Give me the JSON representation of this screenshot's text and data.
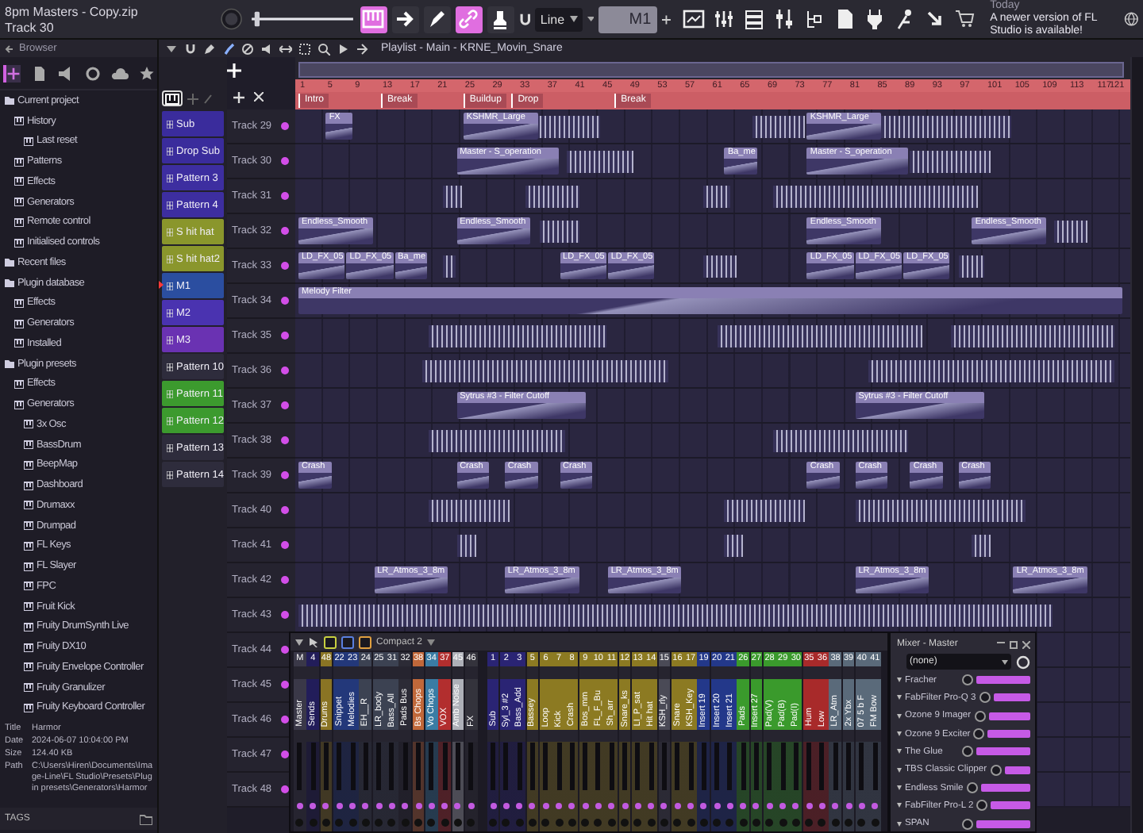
{
  "window": {
    "title": "8pm Masters - Copy.zip",
    "subtitle": "Track 30"
  },
  "toolbar": {
    "master_slider": {
      "level": 0.03
    },
    "toggles": [
      {
        "on": true
      },
      {
        "on": false
      },
      {
        "on": false
      },
      {
        "on": true
      },
      {
        "on": false
      }
    ],
    "snap": "Line",
    "pattern": "M1",
    "notice": {
      "date": "Today",
      "message": "A newer version of FL Studio is available!"
    }
  },
  "browser": {
    "title": "Browser",
    "tabs": [
      {
        "selected": true
      },
      {
        "selected": false
      },
      {
        "selected": false
      },
      {
        "selected": false
      },
      {
        "selected": false
      },
      {
        "selected": false
      }
    ],
    "tree": [
      {
        "label": "Current project",
        "children": [
          {
            "label": "History",
            "children": [
              {
                "label": "Last reset"
              }
            ]
          },
          {
            "label": "Patterns"
          },
          {
            "label": "Effects"
          },
          {
            "label": "Generators"
          },
          {
            "label": "Remote control"
          },
          {
            "label": "Initialised controls"
          }
        ]
      },
      {
        "label": "Recent files"
      },
      {
        "label": "Plugin database",
        "children": [
          {
            "label": "Effects"
          },
          {
            "label": "Generators"
          },
          {
            "label": "Installed"
          }
        ]
      },
      {
        "label": "Plugin presets",
        "children": [
          {
            "label": "Effects"
          },
          {
            "label": "Generators",
            "children": [
              {
                "label": "3x Osc"
              },
              {
                "label": "BassDrum"
              },
              {
                "label": "BeepMap"
              },
              {
                "label": "Dashboard"
              },
              {
                "label": "Drumaxx"
              },
              {
                "label": "Drumpad"
              },
              {
                "label": "FL Keys"
              },
              {
                "label": "FL Slayer"
              },
              {
                "label": "FPC"
              },
              {
                "label": "Fruit Kick"
              },
              {
                "label": "Fruity DrumSynth Live"
              },
              {
                "label": "Fruity DX10"
              },
              {
                "label": "Fruity Envelope Controller"
              },
              {
                "label": "Fruity Granulizer"
              },
              {
                "label": "Fruity Keyboard Controller"
              }
            ]
          }
        ]
      }
    ],
    "info": [
      {
        "label": "Title",
        "value": "Harmor"
      },
      {
        "label": "Date",
        "value": "2024-06-07 10:04:00 PM"
      },
      {
        "label": "Size",
        "value": "124.40 KB"
      },
      {
        "label": "Path",
        "value": "C:\\Users\\Hiren\\Documents\\Image-Line\\FL Studio\\Presets\\Plugin presets\\Generators\\Harmor"
      }
    ],
    "tags": "TAGS"
  },
  "patterns": [
    {
      "name": "Sub",
      "color": "#3a2c9c",
      "selected": false
    },
    {
      "name": "Drop Sub",
      "color": "#3a2c9c",
      "selected": false
    },
    {
      "name": "Pattern 3",
      "color": "#3d2ea0",
      "selected": false
    },
    {
      "name": "Pattern 4",
      "color": "#3d2ea0",
      "selected": false
    },
    {
      "name": "S hit hat",
      "color": "#8a962c",
      "selected": false
    },
    {
      "name": "S hit hat2",
      "color": "#8a962c",
      "selected": false
    },
    {
      "name": "M1",
      "color": "#2b4ea0",
      "selected": true
    },
    {
      "name": "M2",
      "color": "#4a33b0",
      "selected": false
    },
    {
      "name": "M3",
      "color": "#6a32b2",
      "selected": false
    },
    {
      "name": "Pattern 10",
      "color": "#2e2c3c",
      "selected": false
    },
    {
      "name": "Pattern 11",
      "color": "#3c9a2e",
      "selected": false
    },
    {
      "name": "Pattern 12",
      "color": "#3c9a2e",
      "selected": false
    },
    {
      "name": "Pattern 13",
      "color": "#2e2c3c",
      "selected": false
    },
    {
      "name": "Pattern 14",
      "color": "#2e2c3c",
      "selected": false
    }
  ],
  "playlist": {
    "title": "Playlist - Main - KRNE_Movin_Snare",
    "ruler": [
      "1",
      "5",
      "9",
      "13",
      "17",
      "21",
      "25",
      "29",
      "33",
      "37",
      "41",
      "45",
      "49",
      "53",
      "57",
      "61",
      "65",
      "69",
      "73",
      "77",
      "81",
      "85",
      "89",
      "93",
      "97",
      "101",
      "105",
      "109",
      "113",
      "117",
      "121"
    ],
    "markers": [
      "Intro",
      "Break",
      "Buildup",
      "Drop",
      "Break"
    ],
    "tracks": [
      {
        "name": "Track 29",
        "enabled": true,
        "clips": [
          {
            "label": "FX"
          },
          {
            "label": "KSHMR_Large"
          },
          {
            "label": "KSHMR_Large"
          }
        ]
      },
      {
        "name": "Track 30",
        "enabled": true,
        "clips": [
          {
            "label": "Master - S_operation"
          },
          {
            "label": "Ba_me"
          },
          {
            "label": "Master - S_operation"
          }
        ]
      },
      {
        "name": "Track 31",
        "enabled": true
      },
      {
        "name": "Track 32",
        "enabled": true,
        "clips": [
          {
            "label": "Endless_Smooth"
          },
          {
            "label": "Endless_Smooth"
          },
          {
            "label": "Endless_Smooth"
          },
          {
            "label": "Endless_Smooth"
          }
        ]
      },
      {
        "name": "Track 33",
        "enabled": true,
        "clips": [
          {
            "label": "LD_FX_05"
          },
          {
            "label": "LD_FX_05"
          },
          {
            "label": "Ba_me"
          },
          {
            "label": "LD_FX_05"
          },
          {
            "label": "LD_FX_05"
          },
          {
            "label": "LD_FX_05"
          },
          {
            "label": "LD_FX_05"
          },
          {
            "label": "LD_FX_05"
          }
        ]
      },
      {
        "name": "Track 34",
        "enabled": true,
        "clips": [
          {
            "label": "Melody Filter"
          }
        ]
      },
      {
        "name": "Track 35",
        "enabled": true
      },
      {
        "name": "Track 36",
        "enabled": true
      },
      {
        "name": "Track 37",
        "enabled": true,
        "clips": [
          {
            "label": "Sytrus #3 - Filter Cutoff"
          },
          {
            "label": "Sytrus #3 - Filter Cutoff"
          }
        ]
      },
      {
        "name": "Track 38",
        "enabled": true
      },
      {
        "name": "Track 39",
        "enabled": true,
        "clips": [
          {
            "label": "Crash"
          },
          {
            "label": "Crash"
          },
          {
            "label": "Crash"
          },
          {
            "label": "Crash"
          },
          {
            "label": "Crash"
          },
          {
            "label": "Crash"
          },
          {
            "label": "Crash"
          },
          {
            "label": "Crash"
          }
        ]
      },
      {
        "name": "Track 40",
        "enabled": true
      },
      {
        "name": "Track 41",
        "enabled": true
      },
      {
        "name": "Track 42",
        "enabled": true,
        "clips": [
          {
            "label": "LR_Atmos_3_8m"
          },
          {
            "label": "LR_Atmos_3_8m"
          },
          {
            "label": "LR_Atmos_3_8m"
          },
          {
            "label": "LR_Atmos_3_8m"
          },
          {
            "label": "LR_Atmos_3_8m"
          }
        ]
      },
      {
        "name": "Track 43",
        "enabled": true
      },
      {
        "name": "Track 44",
        "enabled": true
      },
      {
        "name": "Track 45",
        "enabled": true
      },
      {
        "name": "Track 46",
        "enabled": true
      },
      {
        "name": "Track 47",
        "enabled": true
      },
      {
        "name": "Track 48",
        "enabled": true
      }
    ]
  },
  "mixer": {
    "preset": "Compact 2",
    "groups": [
      {
        "strips": [
          {
            "number": "M",
            "name": "Master",
            "color": "#3a3848"
          },
          {
            "number": "4",
            "name": "Sends",
            "color": "#221d5a"
          },
          {
            "number": "48",
            "name": "Drums",
            "color": "#8a7424"
          },
          {
            "number": "22",
            "name": "Snippet",
            "color": "#23387a"
          },
          {
            "number": "23",
            "name": "Melodies",
            "color": "#23387a"
          },
          {
            "number": "24",
            "name": "EH__R",
            "color": "#3c4252"
          },
          {
            "number": "25",
            "name": "LR_body",
            "color": "#3c4252"
          },
          {
            "number": "31",
            "name": "Bass_All",
            "color": "#3c4252"
          },
          {
            "number": "32",
            "name": "Pads Bus",
            "color": "#2c2b36"
          },
          {
            "number": "38",
            "name": "Bs Chops",
            "color": "#c0683a"
          },
          {
            "number": "34",
            "name": "Vo Chops",
            "color": "#3a7ca4"
          },
          {
            "number": "37",
            "name": "VOX",
            "color": "#b22e2e"
          },
          {
            "number": "45",
            "name": "Amb Noise",
            "color": "#aeb0b8"
          },
          {
            "number": "46",
            "name": "FX",
            "color": "#34333c"
          }
        ]
      },
      {
        "strips": [
          {
            "number": "1",
            "name": "Sub",
            "color": "#2a2474"
          },
          {
            "number": "2",
            "name": "Syl_3 #2",
            "color": "#2a2474"
          },
          {
            "number": "3",
            "name": "Bass_Add",
            "color": "#2a2474"
          },
          {
            "number": "5",
            "name": "Bassey",
            "color": "#8c7a22"
          },
          {
            "number": "6",
            "name": "Loop",
            "color": "#8c7a22"
          },
          {
            "number": "7",
            "name": "Kick",
            "color": "#8c7a22"
          },
          {
            "number": "8",
            "name": "Crash",
            "color": "#8c7a22"
          },
          {
            "number": "9",
            "name": "Bos_mm",
            "color": "#8c7a22"
          },
          {
            "number": "10",
            "name": "FL_F_Bu",
            "color": "#8c7a22"
          },
          {
            "number": "11",
            "name": "Sh_arr",
            "color": "#8c7a22"
          },
          {
            "number": "12",
            "name": "Snare_ks",
            "color": "#8c7a22"
          },
          {
            "number": "13",
            "name": "LI_P_sat",
            "color": "#8c7a22"
          },
          {
            "number": "14",
            "name": "Hit hat",
            "color": "#8c7a22"
          },
          {
            "number": "15",
            "name": "KSH_rly",
            "color": "#4a4a56"
          },
          {
            "number": "16",
            "name": "Snare",
            "color": "#8c7a22"
          },
          {
            "number": "17",
            "name": "KSH_Key",
            "color": "#8c7a22"
          },
          {
            "number": "19",
            "name": "Insert 19",
            "color": "#23388a"
          },
          {
            "number": "20",
            "name": "Insert 20",
            "color": "#23388a"
          },
          {
            "number": "21",
            "name": "Insert 21",
            "color": "#23388a"
          },
          {
            "number": "26",
            "name": "Pads",
            "color": "#3a9a2c"
          },
          {
            "number": "27",
            "name": "Insert 27",
            "color": "#3a9a2c"
          },
          {
            "number": "28",
            "name": "Pad(V)",
            "color": "#3a9a2c"
          },
          {
            "number": "29",
            "name": "Pad(B)",
            "color": "#3a9a2c"
          },
          {
            "number": "30",
            "name": "Pad(I)",
            "color": "#3a9a2c"
          },
          {
            "number": "35",
            "name": "Hum",
            "color": "#a82a2a"
          },
          {
            "number": "36",
            "name": "Low",
            "color": "#a82a2a"
          },
          {
            "number": "38",
            "name": "LR_Atm",
            "color": "#5a6a7a"
          },
          {
            "number": "39",
            "name": "2x Ybx",
            "color": "#5a6a7a"
          },
          {
            "number": "40",
            "name": "07 5 b F",
            "color": "#5a6a7a"
          },
          {
            "number": "41",
            "name": "FM Bow",
            "color": "#5a6a7a"
          }
        ]
      }
    ]
  },
  "master": {
    "title": "Mixer - Master",
    "preset": "(none)",
    "slots": [
      {
        "name": "Fracher",
        "enabled": true
      },
      {
        "name": "FabFilter Pro-Q 3",
        "enabled": true
      },
      {
        "name": "Ozone 9 Imager",
        "enabled": true
      },
      {
        "name": "Ozone 9 Exciter",
        "enabled": true
      },
      {
        "name": "The Glue",
        "enabled": true
      },
      {
        "name": "TBS Classic Clipper",
        "enabled": true
      },
      {
        "name": "Endless Smile",
        "enabled": true
      },
      {
        "name": "FabFilter Pro-L 2",
        "enabled": true
      },
      {
        "name": "SPAN",
        "enabled": true
      }
    ]
  }
}
